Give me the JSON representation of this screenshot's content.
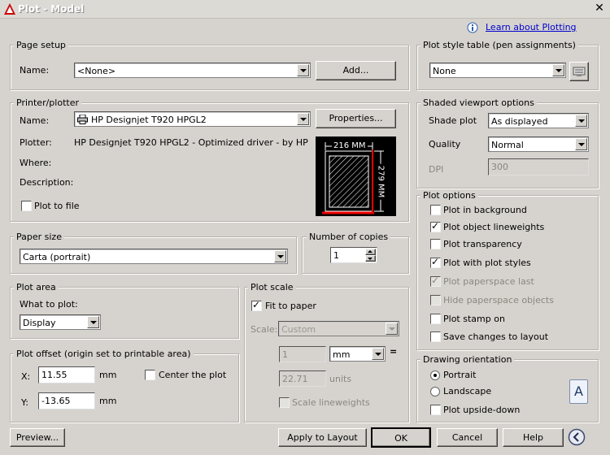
{
  "window": {
    "title": "Plot - Model"
  },
  "help_link": "Learn about Plotting",
  "page_setup": {
    "legend": "Page setup",
    "name_label": "Name:",
    "name_value": "<None>",
    "add_button": "Add..."
  },
  "printer": {
    "legend": "Printer/plotter",
    "name_label": "Name:",
    "name_value": "HP Designjet T920 HPGL2",
    "properties_button": "Properties...",
    "plotter_label": "Plotter:",
    "plotter_value": "HP Designjet T920 HPGL2 - Optimized driver - by HP",
    "where_label": "Where:",
    "description_label": "Description:",
    "plot_to_file": "Plot to file",
    "preview_width": "216 MM",
    "preview_height": "279 MM"
  },
  "paper_size": {
    "legend": "Paper size",
    "value": "Carta (portrait)"
  },
  "copies": {
    "legend": "Number of copies",
    "value": "1"
  },
  "plot_area": {
    "legend": "Plot area",
    "what_label": "What to plot:",
    "value": "Display"
  },
  "plot_offset": {
    "legend": "Plot offset (origin set to printable area)",
    "x_label": "X:",
    "x_value": "11.55",
    "y_label": "Y:",
    "y_value": "-13.65",
    "unit": "mm",
    "center": "Center the plot"
  },
  "plot_scale": {
    "legend": "Plot scale",
    "fit": "Fit to paper",
    "scale_label": "Scale:",
    "scale_value": "Custom",
    "num_value": "1",
    "unit_value": "mm",
    "equals": "=",
    "units_value": "22.71",
    "units_label": "units",
    "scale_lineweights": "Scale lineweights"
  },
  "style_table": {
    "legend": "Plot style table (pen assignments)",
    "value": "None"
  },
  "shaded": {
    "legend": "Shaded viewport options",
    "shade_label": "Shade plot",
    "shade_value": "As displayed",
    "quality_label": "Quality",
    "quality_value": "Normal",
    "dpi_label": "DPI",
    "dpi_value": "300"
  },
  "options": {
    "legend": "Plot options",
    "items": [
      "Plot in background",
      "Plot object lineweights",
      "Plot transparency",
      "Plot with plot styles",
      "Plot paperspace last",
      "Hide paperspace objects",
      "Plot stamp on",
      "Save changes to layout"
    ]
  },
  "orientation": {
    "legend": "Drawing orientation",
    "portrait": "Portrait",
    "landscape": "Landscape",
    "upside_down": "Plot upside-down",
    "glyph": "A"
  },
  "buttons": {
    "preview": "Preview...",
    "apply": "Apply to Layout",
    "ok": "OK",
    "cancel": "Cancel",
    "help": "Help"
  }
}
